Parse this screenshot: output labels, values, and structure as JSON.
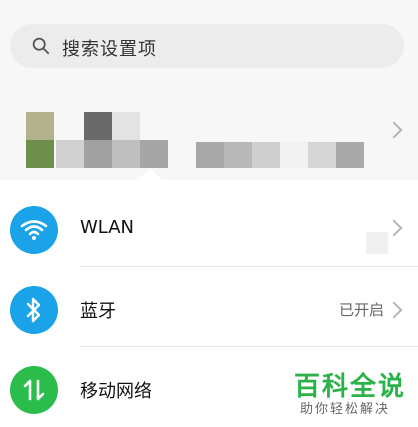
{
  "search": {
    "placeholder": "搜索设置项"
  },
  "account": {
    "name_blurred": ""
  },
  "settings": [
    {
      "label": "WLAN",
      "value": ""
    },
    {
      "label": "蓝牙",
      "value": "已开启"
    },
    {
      "label": "移动网络",
      "value": ""
    }
  ],
  "watermark": {
    "title": "百科全说",
    "subtitle": "助你轻松解决"
  },
  "colors": {
    "wlan_icon": "#1aa3e8",
    "bluetooth_icon": "#1aa3e8",
    "mobile_icon": "#2bbd4b",
    "arrow_annotation": "#e53935",
    "watermark_green": "#2bb34a"
  },
  "icons": {
    "search": "magnifier-icon",
    "wlan": "wifi-icon",
    "bluetooth": "bluetooth-icon",
    "mobile": "mobile-data-arrows-icon"
  }
}
